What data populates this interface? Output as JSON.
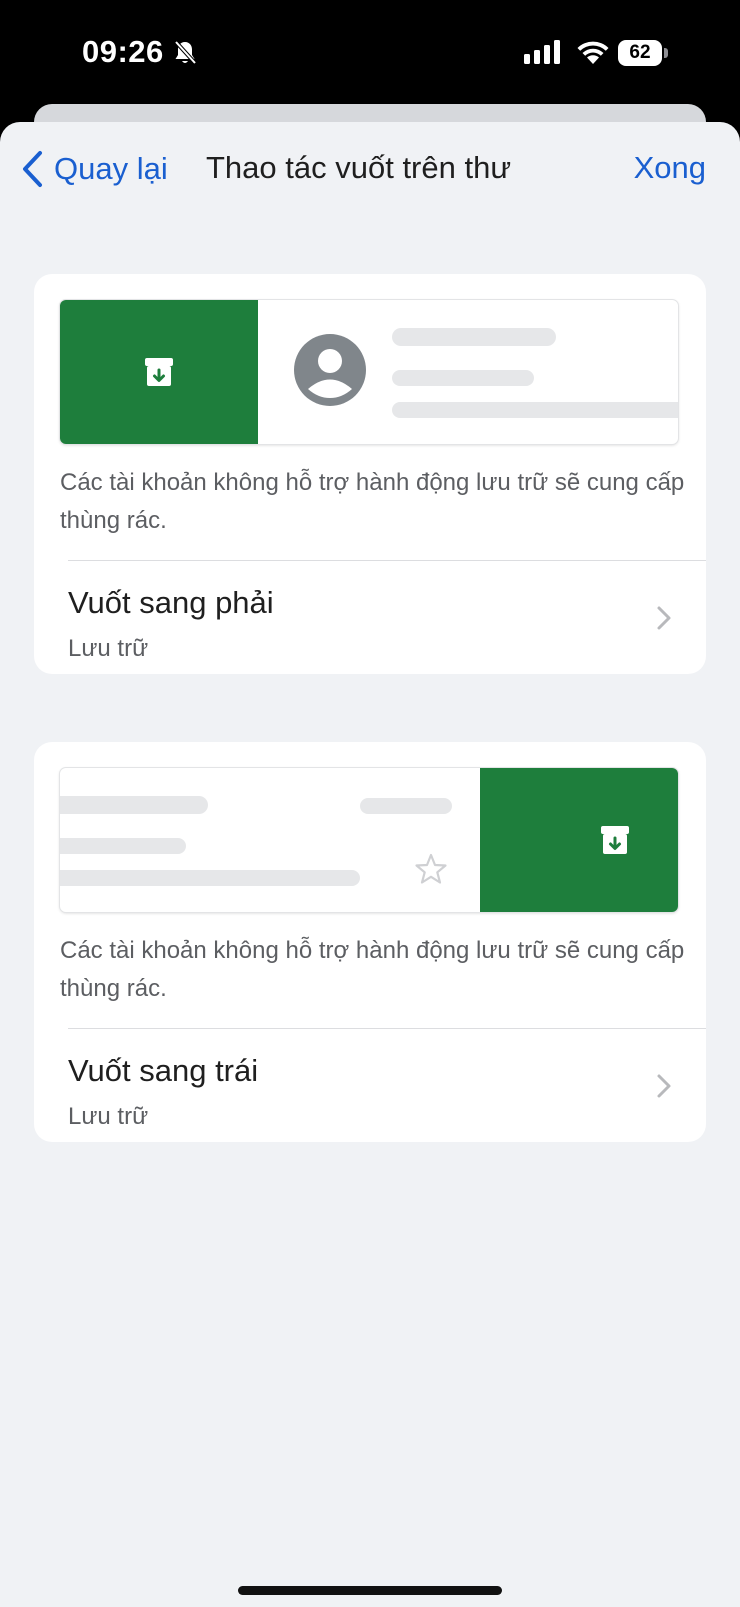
{
  "status_bar": {
    "time": "09:26",
    "battery": "62",
    "icons": [
      "bell-slash-icon",
      "signal-icon",
      "wifi-icon",
      "battery-icon"
    ]
  },
  "nav": {
    "back_label": "Quay lại",
    "title": "Thao tác vuốt trên thư",
    "done_label": "Xong"
  },
  "right_swipe": {
    "note": "Các tài khoản không hỗ trợ hành động lưu trữ sẽ cung cấp thùng rác.",
    "title": "Vuốt sang phải",
    "action": "Lưu trữ"
  },
  "left_swipe": {
    "note": "Các tài khoản không hỗ trợ hành động lưu trữ sẽ cung cấp thùng rác.",
    "title": "Vuốt sang trái",
    "action": "Lưu trữ"
  },
  "colors": {
    "accent": "#1a5fd0",
    "swipe_green": "#1e7e3c",
    "background": "#f0f2f5"
  }
}
